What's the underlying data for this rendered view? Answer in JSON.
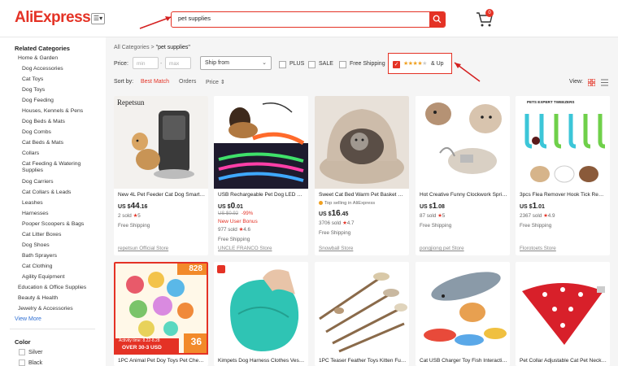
{
  "header": {
    "logo": "AliExpress",
    "menu_icon": "menu-icon",
    "search_value": "pet supplies",
    "cart_count": "0"
  },
  "sidebar": {
    "related_title": "Related Categories",
    "categories": [
      "Home & Garden",
      "Dog Accessories",
      "Cat Toys",
      "Dog Toys",
      "Dog Feeding",
      "Houses, Kennels & Pens",
      "Dog Beds & Mats",
      "Dog Combs",
      "Cat Beds & Mats",
      "Collars",
      "Cat Feeding & Watering Supplies",
      "Dog Carriers",
      "Cat Collars & Leads",
      "Leashes",
      "Harnesses",
      "Pooper Scoopers & Bags",
      "Cat Litter Boxes",
      "Dog Shoes",
      "Bath Sprayers",
      "Cat Clothing",
      "Agility Equipment",
      "Education & Office Supplies",
      "Beauty & Health",
      "Jewelry & Accessories"
    ],
    "view_more": "View More",
    "color_title": "Color",
    "colors": [
      "Silver",
      "Black"
    ]
  },
  "breadcrumb": {
    "root": "All Categories",
    "sep": ">",
    "query": "\"pet supplies\""
  },
  "filters": {
    "price_label": "Price:",
    "min_placeholder": "min",
    "max_placeholder": "max",
    "dash": "-",
    "ship_from": "Ship from",
    "plus": "PLUS",
    "sale": "SALE",
    "free_shipping": "Free Shipping",
    "stars_full": "★★★★",
    "stars_empty": "★",
    "and_up": "& Up"
  },
  "sort": {
    "label": "Sort by:",
    "best_match": "Best Match",
    "orders": "Orders",
    "price": "Price ⇕"
  },
  "view": {
    "label": "View:"
  },
  "accent_color": "#e43225",
  "products": [
    {
      "title": "New 4L Pet Feeder Cat Dog Smart Automatic...",
      "currency": "US $",
      "price_int": "44",
      "price_dec": ".16",
      "sold": "2 sold",
      "rating": "5",
      "shipping": "Free Shipping",
      "store": "repetsun Official Store",
      "brand": "Repetsun"
    },
    {
      "title": "USB Rechargeable Pet Dog LED Glowing Collar",
      "currency": "US $",
      "price_int": "0",
      "price_dec": ".01",
      "orig": "US $0.92",
      "discount": "-99%",
      "promo": "New User Bonus",
      "sold": "977 sold",
      "rating": "4.6",
      "shipping": "Free Shipping",
      "store": "UNCLE FRANCO Store"
    },
    {
      "title": "Sweet Cat Bed Warm Pet Basket Cozy Kitten...",
      "top_tag": "Top selling in AliExpress",
      "currency": "US $",
      "price_int": "16",
      "price_dec": ".45",
      "sold": "3706 sold",
      "rating": "4.7",
      "shipping": "Free Shipping",
      "store": "Snowball Store"
    },
    {
      "title": "Hot Creative Funny Clockwork Spring Power...",
      "currency": "US $",
      "price_int": "1",
      "price_dec": ".08",
      "sold": "87 sold",
      "rating": "5",
      "shipping": "Free Shipping",
      "store": "pongjiong pet Store"
    },
    {
      "title": "3pcs Flea Remover Hook Tick Remover Pet...",
      "currency": "US $",
      "price_int": "1",
      "price_dec": ".01",
      "sold": "2367 sold",
      "rating": "4.9",
      "shipping": "Free Shipping",
      "store": "Florotoets Store",
      "banner": "PETS EXPERT TWEEZERS"
    },
    {
      "title": "1PC Animal Pet Doy Toys Pet Chew Squeaky...",
      "badge": "828",
      "badge2": "36",
      "activity": "Activity time: 8.22-8.28",
      "over": "OVER 30-3 USD"
    },
    {
      "title": "Kimpets Dog Harness Clothes Vest Pet..."
    },
    {
      "title": "1PC Teaser Feather Toys Kitten Funny..."
    },
    {
      "title": "Cat USB Charger Toy Fish Interactive Electric..."
    },
    {
      "title": "Pet Collar Adjustable Cat Pet Neck Scarf..."
    }
  ]
}
